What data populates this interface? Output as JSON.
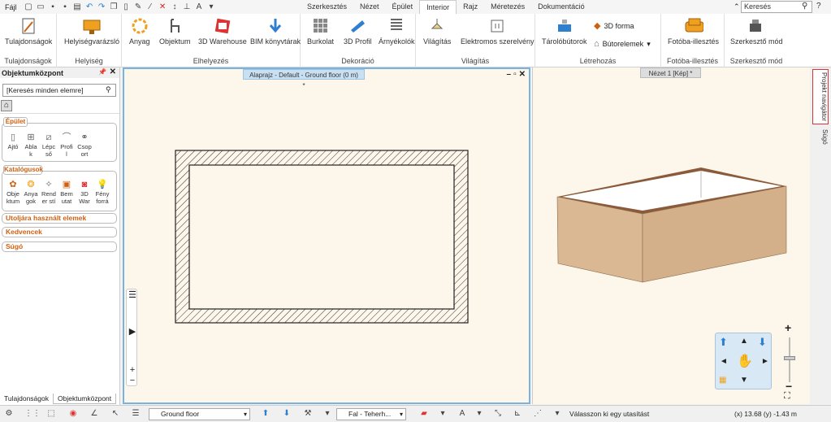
{
  "topbar": {
    "file_menu": "Fájl",
    "tabs": [
      "Szerkesztés",
      "Nézet",
      "Épület",
      "Interior",
      "Rajz",
      "Méretezés",
      "Dokumentáció"
    ],
    "active_tab": "Interior",
    "search_placeholder": "Keresés"
  },
  "ribbon": {
    "tulajdonsagok": {
      "label": "Tulajdonságok",
      "group": "Tulajdonságok"
    },
    "helyiseg": {
      "label": "Helyiségvarázsló",
      "group": "Helyiség"
    },
    "anyag": "Anyag",
    "objektum": "Objektum",
    "warehouse": "3D Warehouse",
    "bim": "BIM könyvtárak",
    "elhelyezes_group": "Elhelyezés",
    "burkolat": "Burkolat",
    "profil": "3D Profil",
    "arnyekolok": "Árnyékolók",
    "dekoracio_group": "Dekoráció",
    "vilagitas": "Világítás",
    "elektromos": "Elektromos szerelvény",
    "vilagitas_group": "Világítás",
    "tarolobutorok": "Tárolóbútorok",
    "forma3d": "3D forma",
    "butorelemek": "Bútorelemek",
    "letrehozas_group": "Létrehozás",
    "foto": {
      "label": "Fotóba-illesztés",
      "group": "Fotóba-illesztés"
    },
    "szerkeszto": {
      "label": "Szerkesztő mód",
      "group": "Szerkesztő mód"
    }
  },
  "left_panel": {
    "title": "Objektumközpont",
    "search_placeholder": "[Keresés minden elemre]",
    "epulet": {
      "title": "Épület",
      "items": [
        "Ajtó",
        "Abla\nk",
        "Lépc\nső",
        "Profi\nl",
        "Csop\nort"
      ]
    },
    "katalogusok": {
      "title": "Katalógusok",
      "items": [
        "Obje\nktum",
        "Anya\ngok",
        "Rend\ner stí",
        "Bem\nutat",
        "3D\nWar",
        "Fény\nforrá"
      ]
    },
    "collapsed": [
      "Utoljára használt elemek",
      "Kedvencek",
      "Súgó"
    ],
    "bottom_tabs": [
      "Tulajdonságok",
      "Objektumközpont"
    ]
  },
  "plan_view": {
    "title": "Alaprajz - Default - Ground floor (0 m) *"
  },
  "view_3d": {
    "title": "Nézet 1 [Kép] *"
  },
  "rail": {
    "tabs": [
      "Projekt navigátor",
      "Súgó"
    ]
  },
  "status": {
    "floor": "Ground floor",
    "layer": "Fal - Teherh...",
    "message": "Válasszon ki egy utasítást",
    "coords": "(x) 13.68  (y) -1.43 m"
  },
  "colors": {
    "accent_orange": "#d06010",
    "view_bg": "#fdf6ea",
    "box_side": "#d9b893",
    "box_front": "#c9a57f"
  }
}
